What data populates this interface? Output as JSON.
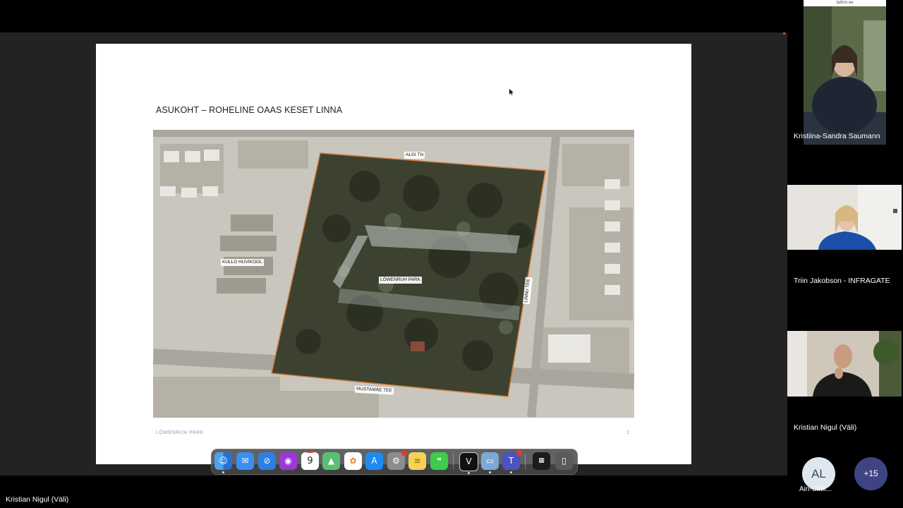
{
  "slide": {
    "title": "ASUKOHT – ROHELINE OAAS KESET LINNA",
    "footer": "LÖWENRUH PARK",
    "page_number": "2",
    "map_labels": {
      "algi": "ALGI TN",
      "kullo": "KULLO HUVIKOOL",
      "park": "LÖWENRUH PARK",
      "linnu": "LINNU TEE",
      "mustamae": "MUSTAMÄE TEE"
    }
  },
  "participants": {
    "url_text": "tallinn.ee",
    "p1": "Kristiina-Sandra Saumann",
    "p2": "Triin Jakobson - INFRAGATE",
    "p3": "Kristian Nigul (Väli)",
    "avatar_initials": "AL",
    "avatar_name": "Airi-Ulrik...",
    "more_count": "+15"
  },
  "speaker_name": "Kristian Nigul (Väli)",
  "dock": {
    "calendar_day": "9",
    "icons": [
      "finder-icon",
      "mail-icon",
      "safari-icon",
      "podcast-icon",
      "calendar-icon",
      "maps-icon",
      "photos-icon",
      "app-store-icon",
      "system-settings-icon",
      "notes-icon",
      "messages-icon",
      "vivaldi-icon",
      "preview-icon",
      "teams-icon",
      "terminal-icon",
      "trash-icon"
    ]
  },
  "colors": {
    "stage": "#232323",
    "park_boundary": "#d07a3a",
    "teams_purple": "#3e4482"
  }
}
